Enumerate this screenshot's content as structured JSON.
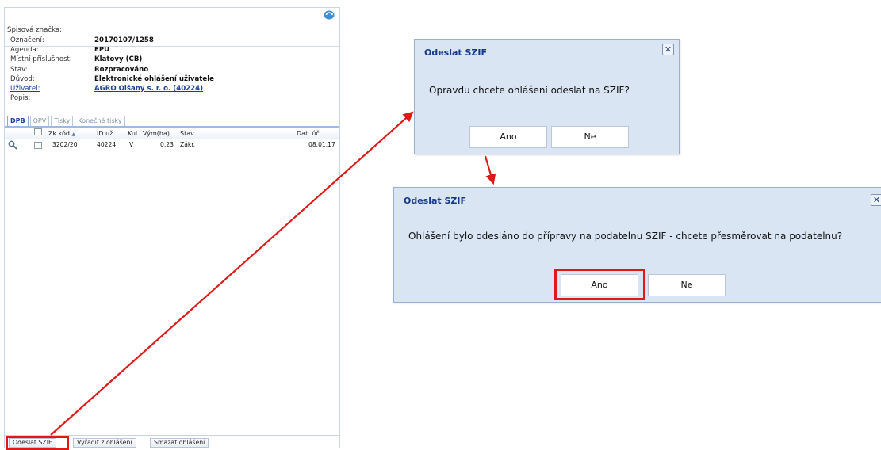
{
  "panel": {
    "refresh_icon": "refresh-icon",
    "file_label": "Spisová značka:",
    "fields": [
      {
        "label": "Označení:",
        "value": "20170107/1258"
      },
      {
        "label": "Agenda:",
        "value": "EPU"
      },
      {
        "label": "Místní příslušnost:",
        "value": "Klatovy (CB)"
      },
      {
        "label": "Stav:",
        "value": "Rozpracováno"
      },
      {
        "label": "Důvod:",
        "value": "Elektronické ohlášení uživatele"
      },
      {
        "label": "Uživatel:",
        "value": "AGRO Olšany s. r. o. (40224)"
      },
      {
        "label": "Popis:",
        "value": ""
      }
    ],
    "tabs": [
      "DPB",
      "OPV",
      "Tisky",
      "Konečné tisky"
    ],
    "grid": {
      "columns": [
        "Zk.kód",
        "ID už.",
        "Kul.",
        "Vým(ha)",
        "Stav",
        "Dat. úč."
      ],
      "sort_indicator": "▲",
      "rows": [
        {
          "code": "3202/20",
          "user_id": "40224",
          "culture": "V",
          "area": "0,23",
          "state": "Zákr.",
          "date": "08.01.17"
        }
      ]
    },
    "buttons": {
      "send": "Odeslat SZIF",
      "remove": "Vyřadit z ohlášení",
      "delete": "Smazat ohlášení"
    }
  },
  "dialog1": {
    "title": "Odeslat SZIF",
    "message": "Opravdu chcete ohlášení odeslat na SZIF?",
    "yes": "Ano",
    "no": "Ne"
  },
  "dialog2": {
    "title": "Odeslat SZIF",
    "message": "Ohlášení bylo odesláno do přípravy na podatelnu SZIF - chcete přesměrovat na podatelnu?",
    "yes": "Ano",
    "no": "Ne"
  },
  "colors": {
    "highlight": "#e01818",
    "dialog_bg": "#d9e5f3",
    "title_blue": "#15398a"
  }
}
